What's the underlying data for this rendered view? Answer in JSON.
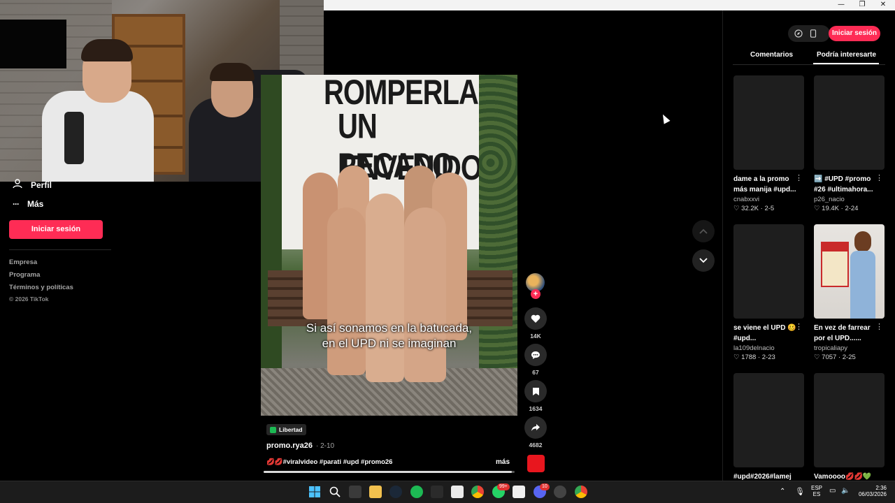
{
  "window": {
    "minimize": "—",
    "restore": "❐",
    "close": "✕"
  },
  "sidebar": {
    "items": [
      {
        "label": "Perfil",
        "icon": "person-icon"
      },
      {
        "label": "Más",
        "icon": "more-dots-icon"
      }
    ],
    "login_button": "Iniciar sesión",
    "footer_links": [
      "Empresa",
      "Programa",
      "Términos y políticas"
    ],
    "copyright": "© 2026 TikTok"
  },
  "video": {
    "banner_lines": [
      "ROMPERLA",
      "UN PECADO",
      "ENVENIDOS"
    ],
    "caption_lines": [
      "Si así sonamos en la batucada,",
      "en el UPD ni se imaginan"
    ],
    "tag": "Libertad",
    "author": "promo.rya26",
    "date": "· 2-10",
    "description": "💋💋#viralvideo #parati #upd #promo26",
    "more": "más",
    "progress": 0.99
  },
  "actions": {
    "likes": "14K",
    "comments": "67",
    "saves": "1634",
    "shares": "4682"
  },
  "right_panel": {
    "login_button": "Iniciar sesión",
    "tabs": [
      {
        "label": "Comentarios",
        "active": false
      },
      {
        "label": "Podría interesarte",
        "active": true
      }
    ],
    "cards": [
      {
        "title": "dame a la promo más manija #upd...",
        "user": "cnabxxvi",
        "likes": "32.2K",
        "date": "2-5"
      },
      {
        "title": "➡️ #UPD #promo #26 #ultimahora...",
        "user": "p26_nacio",
        "likes": "19.4K",
        "date": "2-24"
      },
      {
        "title": "se viene el UPD 🥴 #upd...",
        "user": "la109delnacio",
        "likes": "1788",
        "date": "2-23"
      },
      {
        "title": "En vez de farrear por el UPD......",
        "user": "tropicaliapy",
        "likes": "7057",
        "date": "2-25"
      },
      {
        "title": "#upd#2026#lamej",
        "user": "",
        "likes": "",
        "date": ""
      },
      {
        "title": "Vamoooo💋💋💚",
        "user": "",
        "likes": "",
        "date": ""
      }
    ],
    "newspaper_label": "CRONICA"
  },
  "taskbar": {
    "lang_top": "ESP",
    "lang_bottom": "ES",
    "time": "2:36",
    "date": "06/03/2026",
    "badge_whatsapp": "99+",
    "badge_discord": "10"
  },
  "colors": {
    "accent": "#fe2c55",
    "bg": "#000000",
    "panel": "#1e1e1e"
  }
}
